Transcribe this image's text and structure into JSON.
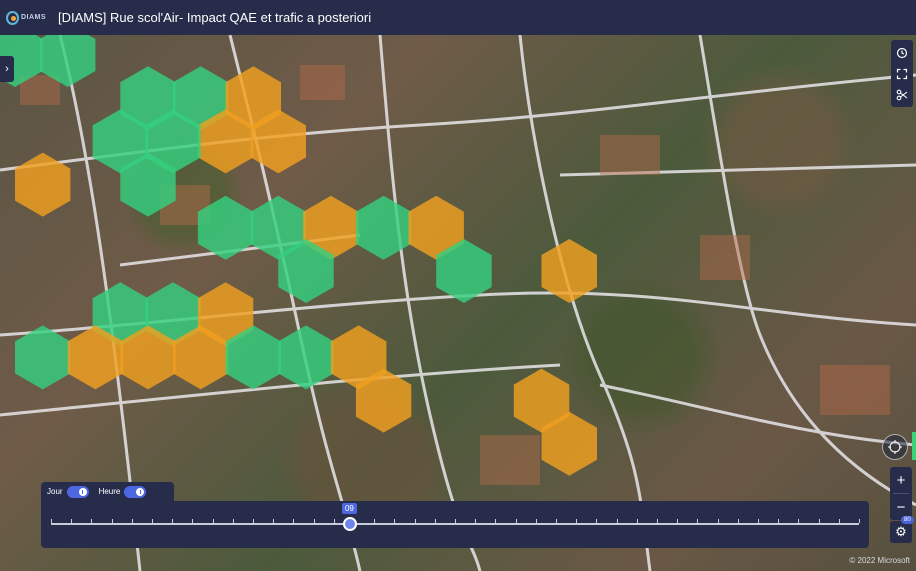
{
  "header": {
    "logo_text": "DIAMS",
    "title": "[DIAMS] Rue scol'Air- Impact QAE et trafic a posteriori"
  },
  "colors": {
    "header_bg": "#272c4a",
    "hex_green": "#35d07f",
    "hex_orange": "#f0a020",
    "accent": "#4c67e0"
  },
  "map": {
    "hexes": [
      {
        "col": 0,
        "row": 0,
        "status": "green"
      },
      {
        "col": 1,
        "row": 0,
        "status": "green"
      },
      {
        "col": 2,
        "row": 1,
        "status": "green"
      },
      {
        "col": 3,
        "row": 1,
        "status": "green"
      },
      {
        "col": 4,
        "row": 1,
        "status": "orange"
      },
      {
        "col": 4,
        "row": 2,
        "status": "orange"
      },
      {
        "col": 5,
        "row": 2,
        "status": "orange"
      },
      {
        "col": 2,
        "row": 2,
        "status": "green"
      },
      {
        "col": 3,
        "row": 2,
        "status": "green"
      },
      {
        "col": 2,
        "row": 3,
        "status": "green"
      },
      {
        "col": 0,
        "row": 3,
        "status": "orange"
      },
      {
        "col": 4,
        "row": 4,
        "status": "green"
      },
      {
        "col": 5,
        "row": 4,
        "status": "green"
      },
      {
        "col": 6,
        "row": 4,
        "status": "orange"
      },
      {
        "col": 7,
        "row": 4,
        "status": "green"
      },
      {
        "col": 8,
        "row": 4,
        "status": "orange"
      },
      {
        "col": 8,
        "row": 5,
        "status": "green"
      },
      {
        "col": 10,
        "row": 5,
        "status": "orange"
      },
      {
        "col": 5,
        "row": 5,
        "status": "green"
      },
      {
        "col": 2,
        "row": 6,
        "status": "green"
      },
      {
        "col": 3,
        "row": 6,
        "status": "green"
      },
      {
        "col": 4,
        "row": 6,
        "status": "orange"
      },
      {
        "col": 0,
        "row": 7,
        "status": "green"
      },
      {
        "col": 1,
        "row": 7,
        "status": "orange"
      },
      {
        "col": 2,
        "row": 7,
        "status": "orange"
      },
      {
        "col": 3,
        "row": 7,
        "status": "orange"
      },
      {
        "col": 4,
        "row": 7,
        "status": "green"
      },
      {
        "col": 5,
        "row": 7,
        "status": "green"
      },
      {
        "col": 6,
        "row": 7,
        "status": "orange"
      },
      {
        "col": 7,
        "row": 8,
        "status": "orange"
      },
      {
        "col": 10,
        "row": 8,
        "status": "orange"
      },
      {
        "col": 10,
        "row": 9,
        "status": "orange"
      }
    ],
    "copyright": "© 2022 Microsoft"
  },
  "controls": {
    "collapse_icon": "chevron-right-icon",
    "tools": [
      "clock-icon",
      "expand-icon",
      "scissors-icon"
    ],
    "zoom_in": "+",
    "zoom_out": "−",
    "settings_badge": "80"
  },
  "time_slider": {
    "toggles": [
      {
        "label": "Jour",
        "on": true
      },
      {
        "label": "Heure",
        "on": true
      }
    ],
    "current_label": "09",
    "position_fraction": 0.37,
    "tick_count": 41
  }
}
